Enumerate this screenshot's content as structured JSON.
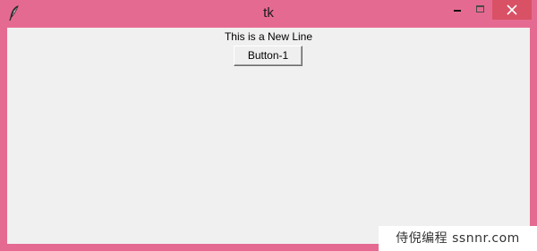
{
  "window": {
    "title": "tk",
    "controls": {
      "minimize": "minimize-icon",
      "maximize": "maximize-icon",
      "close": "close-icon"
    },
    "colors": {
      "frame": "#e56a91",
      "close_button": "#d95165",
      "client_background": "#f0f0f0"
    }
  },
  "content": {
    "label_text": "This is a New Line",
    "button_label": "Button-1"
  },
  "watermark": {
    "text": "侍倪编程 ssnnr.com"
  }
}
